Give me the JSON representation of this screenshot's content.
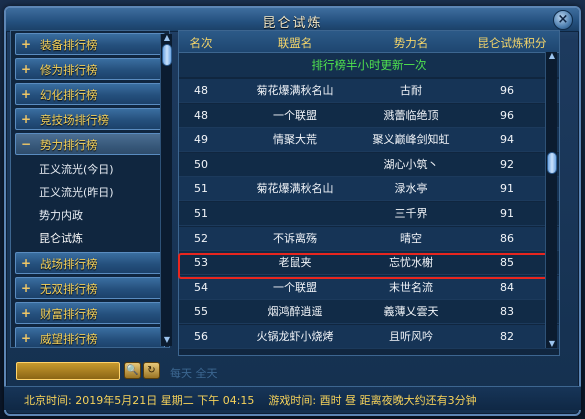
{
  "window": {
    "title": "昆仑试炼",
    "close_label": "×"
  },
  "sidebar": {
    "categories": [
      {
        "label": "装备排行榜",
        "marker": "+"
      },
      {
        "label": "修为排行榜",
        "marker": "+"
      },
      {
        "label": "幻化排行榜",
        "marker": "+"
      },
      {
        "label": "竞技场排行榜",
        "marker": "+"
      },
      {
        "label": "势力排行榜",
        "marker": "−"
      }
    ],
    "sub_items": [
      {
        "label": "正义流光(今日)"
      },
      {
        "label": "正义流光(昨日)"
      },
      {
        "label": "势力内政"
      },
      {
        "label": "昆仑试炼"
      }
    ],
    "categories_after": [
      {
        "label": "战场排行榜",
        "marker": "+"
      },
      {
        "label": "无双排行榜",
        "marker": "+"
      },
      {
        "label": "财富排行榜",
        "marker": "+"
      },
      {
        "label": "威望排行榜",
        "marker": "+"
      }
    ]
  },
  "table": {
    "headers": {
      "rank": "名次",
      "union": "联盟名",
      "force": "势力名",
      "score": "昆仑试炼积分"
    },
    "notice": "排行榜半小时更新一次",
    "rows": [
      {
        "rank": "48",
        "union": "菊花爆满秋名山",
        "force": "古耐",
        "score": "96"
      },
      {
        "rank": "48",
        "union": "一个联盟",
        "force": "溅蕾临绝顶",
        "score": "96"
      },
      {
        "rank": "49",
        "union": "情聚大荒",
        "force": "聚义巅峰剑知虹",
        "score": "94"
      },
      {
        "rank": "50",
        "union": "",
        "force": "湖心小筑丶",
        "score": "92"
      },
      {
        "rank": "51",
        "union": "菊花爆满秋名山",
        "force": "渌水亭",
        "score": "91"
      },
      {
        "rank": "51",
        "union": "",
        "force": "三千界",
        "score": "91"
      },
      {
        "rank": "52",
        "union": "不诉离殇",
        "force": "晴空",
        "score": "86"
      },
      {
        "rank": "53",
        "union": "老鼠夹",
        "force": "忘忧水榭",
        "score": "85"
      },
      {
        "rank": "54",
        "union": "一个联盟",
        "force": "末世名流",
        "score": "84"
      },
      {
        "rank": "55",
        "union": "烟鸿醉逍遥",
        "force": "義薄乂雲天",
        "score": "83"
      },
      {
        "rank": "56",
        "union": "火锅龙虾小烧烤",
        "force": "且听风吟",
        "score": "82"
      }
    ]
  },
  "bottom": {
    "search_value": "",
    "ghost": "每天 全天"
  },
  "status": {
    "beijing_label": "北京时间:",
    "beijing_value": "2019年5月21日 星期二 下午 04:15",
    "game_label": "游戏时间:",
    "game_value": "酉时 昼 距离夜晚大约还有3分钟"
  }
}
